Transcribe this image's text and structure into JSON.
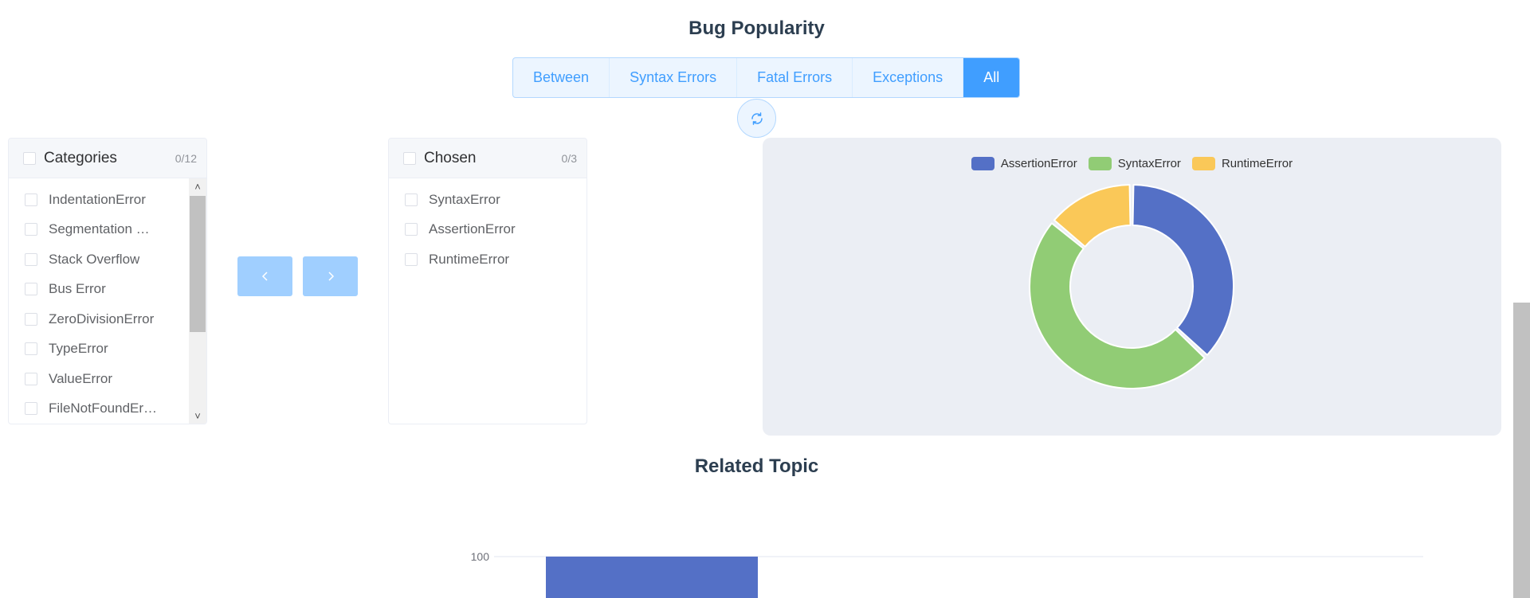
{
  "titles": {
    "bug_popularity": "Bug Popularity",
    "related_topic": "Related Topic"
  },
  "tabs": [
    {
      "label": "Between",
      "active": false
    },
    {
      "label": "Syntax Errors",
      "active": false
    },
    {
      "label": "Fatal Errors",
      "active": false
    },
    {
      "label": "Exceptions",
      "active": false
    },
    {
      "label": "All",
      "active": true
    }
  ],
  "transfer": {
    "left": {
      "title": "Categories",
      "count": "0/12",
      "items": [
        "IndentationError",
        "Segmentation …",
        "Stack Overflow",
        "Bus Error",
        "ZeroDivisionError",
        "TypeError",
        "ValueError",
        "FileNotFoundEr…"
      ]
    },
    "right": {
      "title": "Chosen",
      "count": "0/3",
      "items": [
        "SyntaxError",
        "AssertionError",
        "RuntimeError"
      ]
    }
  },
  "icons": {
    "refresh": "refresh-icon",
    "move_left": "chevron-left-icon",
    "move_right": "chevron-right-icon",
    "scroll_up": "caret-up-icon",
    "scroll_down": "caret-down-icon"
  },
  "colors": {
    "primary": "#409eff",
    "assertion": "#5470c6",
    "syntax": "#91cc75",
    "runtime": "#fac858"
  },
  "chart_data": [
    {
      "type": "pie",
      "variant": "donut",
      "legend_position": "top",
      "series": [
        {
          "name": "AssertionError",
          "value": 37,
          "color": "#5470c6"
        },
        {
          "name": "SyntaxError",
          "value": 49,
          "color": "#91cc75"
        },
        {
          "name": "RuntimeError",
          "value": 14,
          "color": "#fac858"
        }
      ]
    },
    {
      "type": "bar",
      "partially_visible": true,
      "y_tick_labels": [
        "100"
      ],
      "values": [
        100
      ],
      "color": "#5470c6"
    }
  ]
}
